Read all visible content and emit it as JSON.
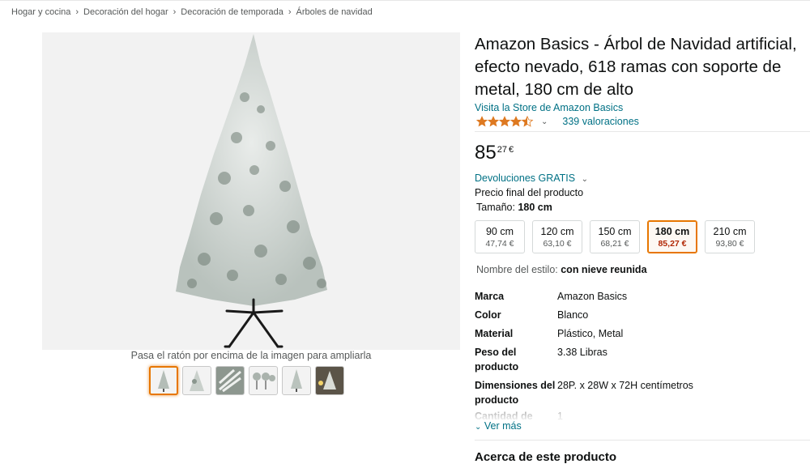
{
  "breadcrumb": {
    "items": [
      "Hogar y cocina",
      "Decoración del hogar",
      "Decoración de temporada",
      "Árboles de navidad"
    ],
    "separator": "›"
  },
  "gallery": {
    "hover_hint": "Pasa el ratón por encima de la imagen para ampliarla",
    "thumbnail_count": 6,
    "selected_thumbnail": 1
  },
  "product": {
    "title": "Amazon Basics - Árbol de Navidad artificial, efecto nevado, 618 ramas con soporte de metal, 180 cm de alto",
    "store_link": "Visita la Store de Amazon Basics",
    "rating_stars": 4.5,
    "rating_count": "339 valoraciones",
    "rating_chevron": "⌄",
    "price_whole": "85",
    "price_fraction": "27",
    "price_currency": "€",
    "returns": "Devoluciones GRATIS",
    "returns_chevron": "⌄",
    "final_price": "Precio final del producto"
  },
  "size": {
    "label": "Tamaño:",
    "selected_value": "180 cm",
    "options": [
      {
        "name": "90 cm",
        "price": "47,74 €"
      },
      {
        "name": "120 cm",
        "price": "63,10 €"
      },
      {
        "name": "150 cm",
        "price": "68,21 €"
      },
      {
        "name": "180 cm",
        "price": "85,27 €"
      },
      {
        "name": "210 cm",
        "price": "93,80 €"
      }
    ],
    "selected_index": 3
  },
  "style": {
    "label": "Nombre del estilo:",
    "value": "con nieve reunida"
  },
  "specs": [
    {
      "key": "Marca",
      "value": "Amazon Basics"
    },
    {
      "key": "Color",
      "value": "Blanco"
    },
    {
      "key": "Material",
      "value": "Plástico, Metal"
    },
    {
      "key": "Peso del producto",
      "value": "3.38 Libras"
    },
    {
      "key": "Dimensiones del producto",
      "value": "28P. x 28W x 72H centímetros"
    }
  ],
  "specs_truncated": {
    "key": "Cantidad de",
    "value": "1"
  },
  "see_more": "Ver más",
  "see_more_chevron": "⌄",
  "about_heading": "Acerca de este producto",
  "colors": {
    "link": "#007185",
    "star": "#de7921",
    "selected_border": "#e77600",
    "selected_price": "#b12704"
  },
  "icons": {
    "star": "star-icon",
    "chevron": "chevron-down-icon",
    "tree": "christmas-tree-image"
  }
}
